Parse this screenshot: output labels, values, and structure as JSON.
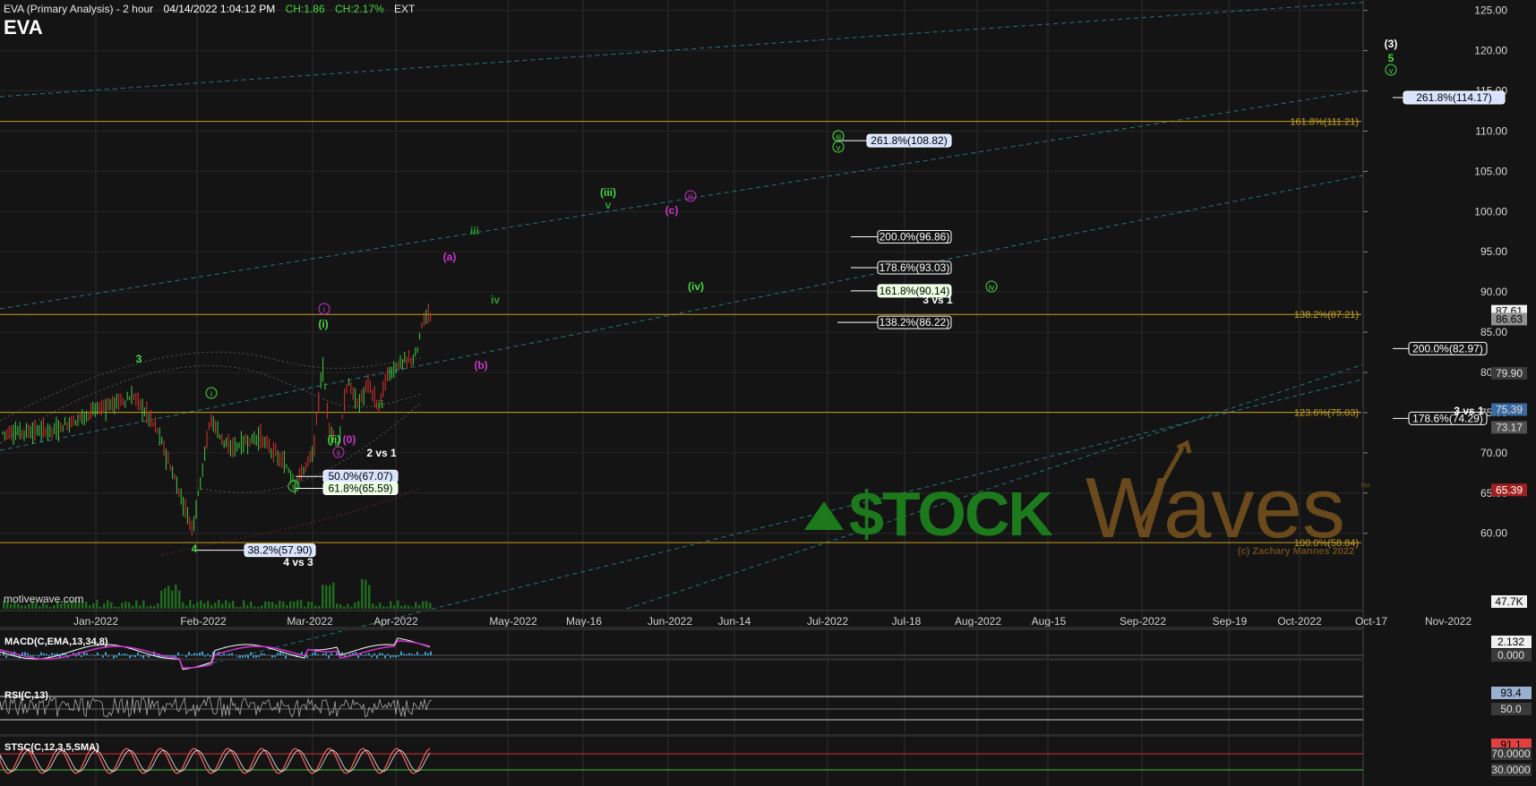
{
  "header": {
    "title": "EVA (Primary Analysis) - 2 hour",
    "datetime": "04/14/2022 1:04:12 PM",
    "change": "CH:1.86",
    "change_pct": "CH:2.17%",
    "session": "EXT",
    "symbol": "EVA"
  },
  "colors": {
    "background": "#141414",
    "fib_line": "#c8a020",
    "channel": "#2a8f9c",
    "up_candle": "#3fcf3f",
    "down_candle": "#e03030",
    "green_label": "#49d645",
    "magenta_label": "#cc33cc",
    "watermark_green": "#1c7a1c",
    "watermark_brown": "#6a4a1c"
  },
  "chart_data": {
    "type": "candlestick",
    "x_axis": {
      "tick_labels": [
        "Jan-2022",
        "Feb-2022",
        "Mar-2022",
        "Apr-2022",
        "May-2022",
        "May-16",
        "Jun-2022",
        "Jun-14",
        "Jul-2022",
        "Jul-18",
        "Aug-2022",
        "Aug-15",
        "Sep-2022",
        "Sep-19",
        "Oct-2022",
        "Oct-17",
        "Nov-2022"
      ]
    },
    "y_axis": {
      "ylim": [
        57.3,
        126.3
      ],
      "tick_labels": [
        "125.00",
        "120.00",
        "115.00",
        "110.00",
        "105.00",
        "100.00",
        "95.00",
        "90.00",
        "85.00",
        "80.00",
        "75.00",
        "70.00",
        "65.00",
        "60.00"
      ],
      "tick_values": [
        125,
        120,
        115,
        110,
        105,
        100,
        95,
        90,
        85,
        80,
        75,
        70,
        65,
        60
      ]
    },
    "price_tags": [
      {
        "label": "87.61",
        "value": 87.61,
        "color": "#f0f0f0",
        "text_color": "#000000"
      },
      {
        "label": "86.63",
        "value": 86.63,
        "color": "#909090",
        "text_color": "#000000"
      },
      {
        "label": "79.90",
        "value": 79.9,
        "color": "#3a3a3a",
        "text_color": "#e0e0e0"
      },
      {
        "label": "75.39",
        "value": 75.39,
        "color": "#3a6aa0",
        "text_color": "#e0e0e0"
      },
      {
        "label": "73.17",
        "value": 73.17,
        "color": "#505050",
        "text_color": "#e0e0e0"
      },
      {
        "label": "65.39",
        "value": 65.39,
        "color": "#a02020",
        "text_color": "#ffffff"
      },
      {
        "label": "47.7K",
        "value": null,
        "color": "#f0f0f0",
        "text_color": "#000000"
      }
    ],
    "fib_levels": [
      {
        "label": "161.8%(111.21)",
        "value": 111.21
      },
      {
        "label": "138.2%(87.21)",
        "value": 87.21
      },
      {
        "label": "123.6%(75.03)",
        "value": 75.03
      },
      {
        "label": "100.0%(58.84)",
        "value": 58.84
      }
    ],
    "target_boxes": [
      {
        "label": "261.8%(108.82)",
        "value": 108.82,
        "style": "blue"
      },
      {
        "label": "200.0%(96.86)",
        "value": 96.86,
        "style": "white"
      },
      {
        "label": "178.6%(93.03)",
        "value": 93.03,
        "style": "white"
      },
      {
        "label": "161.8%(90.14)",
        "value": 90.14,
        "style": "green"
      },
      {
        "label": "138.2%(86.22)",
        "value": 86.22,
        "style": "white"
      },
      {
        "label": "261.8%(114.17)",
        "value": 114.17,
        "style": "blue"
      },
      {
        "label": "200.0%(82.97)",
        "value": 82.97,
        "style": "white"
      },
      {
        "label": "178.6%(74.29)",
        "value": 74.29,
        "style": "white"
      },
      {
        "label": "50.0%(67.07)",
        "value": 67.07,
        "style": "blue"
      },
      {
        "label": "61.8%(65.59)",
        "value": 65.59,
        "style": "green"
      },
      {
        "label": "38.2%(57.90)",
        "value": 57.9,
        "style": "blue"
      }
    ],
    "plain_labels": [
      {
        "text": "3 vs 1",
        "color": "#ffffff"
      },
      {
        "text": "3 vs 1",
        "color": "#ffffff"
      },
      {
        "text": "2 vs 1",
        "color": "#ffffff"
      },
      {
        "text": "4 vs 3",
        "color": "#ffffff"
      }
    ],
    "wave_labels": [
      {
        "text": "3",
        "color": "#49d645"
      },
      {
        "text": "4",
        "color": "#49d645"
      },
      {
        "text": "(3)",
        "color": "#ffffff"
      },
      {
        "text": "5",
        "color": "#49d645"
      },
      {
        "text": "(a)",
        "color": "#cc33cc"
      },
      {
        "text": "(b)",
        "color": "#cc33cc"
      },
      {
        "text": "(c)",
        "color": "#cc33cc"
      },
      {
        "text": "(i)",
        "color": "#49d645"
      },
      {
        "text": "(ii)",
        "color": "#49d645"
      },
      {
        "text": "(iii)",
        "color": "#49d645"
      },
      {
        "text": "(iv)",
        "color": "#49d645"
      },
      {
        "text": "(0)",
        "color": "#cc33cc"
      },
      {
        "text": "iii",
        "color": "#2f9f2f"
      },
      {
        "text": "iv",
        "color": "#2f9f2f"
      },
      {
        "text": "v",
        "color": "#2f9f2f"
      },
      {
        "text": "ii",
        "color": "#2f9f2f"
      }
    ],
    "circle_labels": [
      {
        "text": "i",
        "color": "#49d645"
      },
      {
        "text": "ii",
        "color": "#49d645"
      },
      {
        "text": "iii",
        "color": "#49d645"
      },
      {
        "text": "iv",
        "color": "#49d645"
      },
      {
        "text": "v",
        "color": "#49d645"
      },
      {
        "text": "v",
        "color": "#49d645"
      },
      {
        "text": "i",
        "color": "#cc33cc"
      },
      {
        "text": "ii",
        "color": "#cc33cc"
      },
      {
        "text": "iii",
        "color": "#cc33cc"
      },
      {
        "text": "iii",
        "color": "#49d645"
      }
    ],
    "indicators": [
      {
        "name": "MACD(C,EMA,13,34,8)",
        "tags": [
          {
            "label": "2.132",
            "color": "#f0f0f0"
          },
          {
            "label": "0.000",
            "color": "#3a3a3a"
          }
        ]
      },
      {
        "name": "RSI(C,13)",
        "tags": [
          {
            "label": "93.4",
            "color": "#9ab0d0"
          },
          {
            "label": "50.0",
            "color": "#3a3a3a"
          }
        ]
      },
      {
        "name": "STSC(C,12,3,5,SMA)",
        "tags": [
          {
            "label": "91.1",
            "color": "#e04040"
          },
          {
            "label": "70.0000",
            "color": "#3a3a3a"
          },
          {
            "label": "30.0000",
            "color": "#3a3a3a"
          }
        ]
      }
    ],
    "watermark": {
      "brand_left": "$TOCK",
      "brand_right": "Waves",
      "trademark": "™",
      "copyright": "(c) Zachary Mannes 2022"
    }
  },
  "footer": {
    "source": "motivewave.com"
  }
}
